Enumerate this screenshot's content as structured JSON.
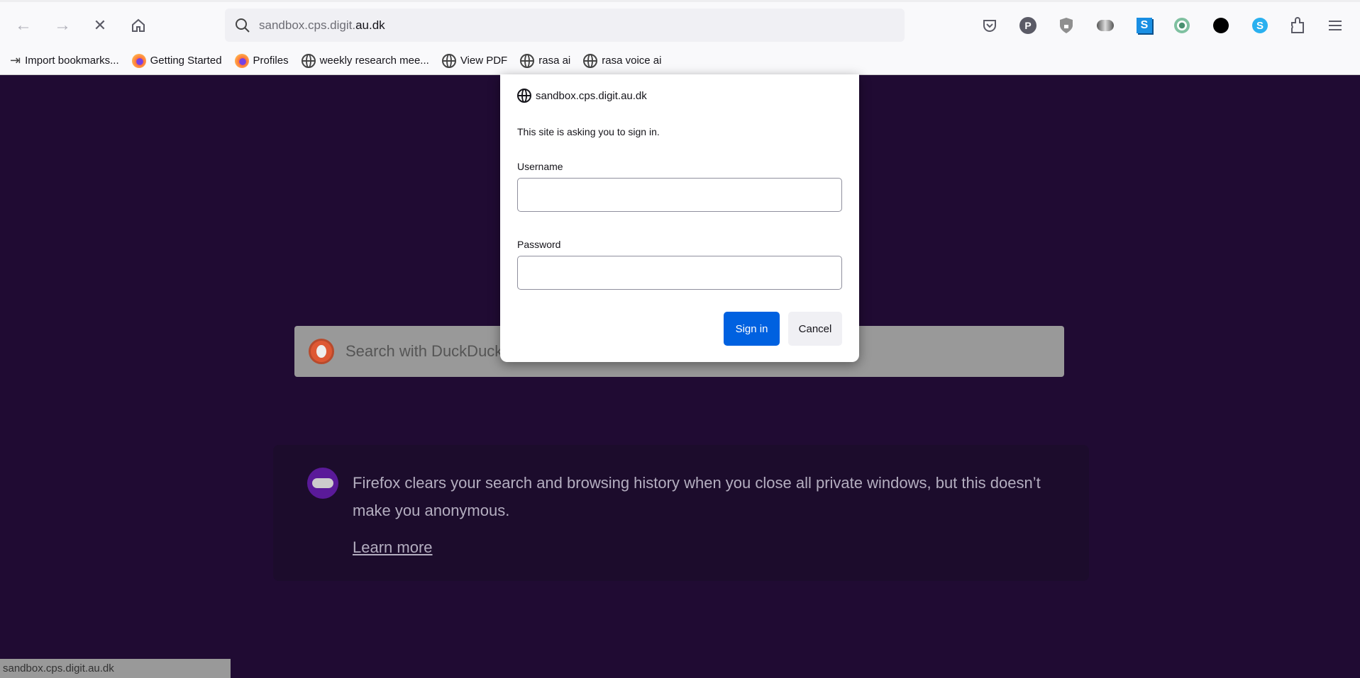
{
  "toolbar": {
    "url_host": "sandbox.cps.digit.",
    "url_domain": "au.dk",
    "extensions": [
      "pocket-icon",
      "privacy-pass-icon",
      "shield-lock-icon",
      "privacy-badger-icon",
      "s-extension-icon",
      "green-circle-extension-icon",
      "black-face-extension-icon",
      "skype-icon",
      "extensions-puzzle-icon",
      "menu-icon"
    ]
  },
  "bookmarks": [
    {
      "label": "Import bookmarks...",
      "icon": "import-icon"
    },
    {
      "label": "Getting Started",
      "icon": "firefox-icon"
    },
    {
      "label": "Profiles",
      "icon": "firefox-icon"
    },
    {
      "label": "weekly research mee...",
      "icon": "globe-icon"
    },
    {
      "label": "View PDF",
      "icon": "globe-icon"
    },
    {
      "label": "rasa ai",
      "icon": "globe-icon"
    },
    {
      "label": "rasa voice ai",
      "icon": "globe-icon"
    }
  ],
  "search": {
    "placeholder": "Search with DuckDuck"
  },
  "notice": {
    "text": "Firefox clears your search and browsing history when you close all private windows, but this doesn’t make you anonymous.",
    "link": "Learn more"
  },
  "status": "sandbox.cps.digit.au.dk",
  "dialog": {
    "host": "sandbox.cps.digit.au.dk",
    "message": "This site is asking you to sign in.",
    "username_label": "Username",
    "username_value": "",
    "password_label": "Password",
    "password_value": "",
    "signin": "Sign in",
    "cancel": "Cancel"
  },
  "colors": {
    "accent": "#0061e0",
    "page_bg": "#200b33"
  }
}
